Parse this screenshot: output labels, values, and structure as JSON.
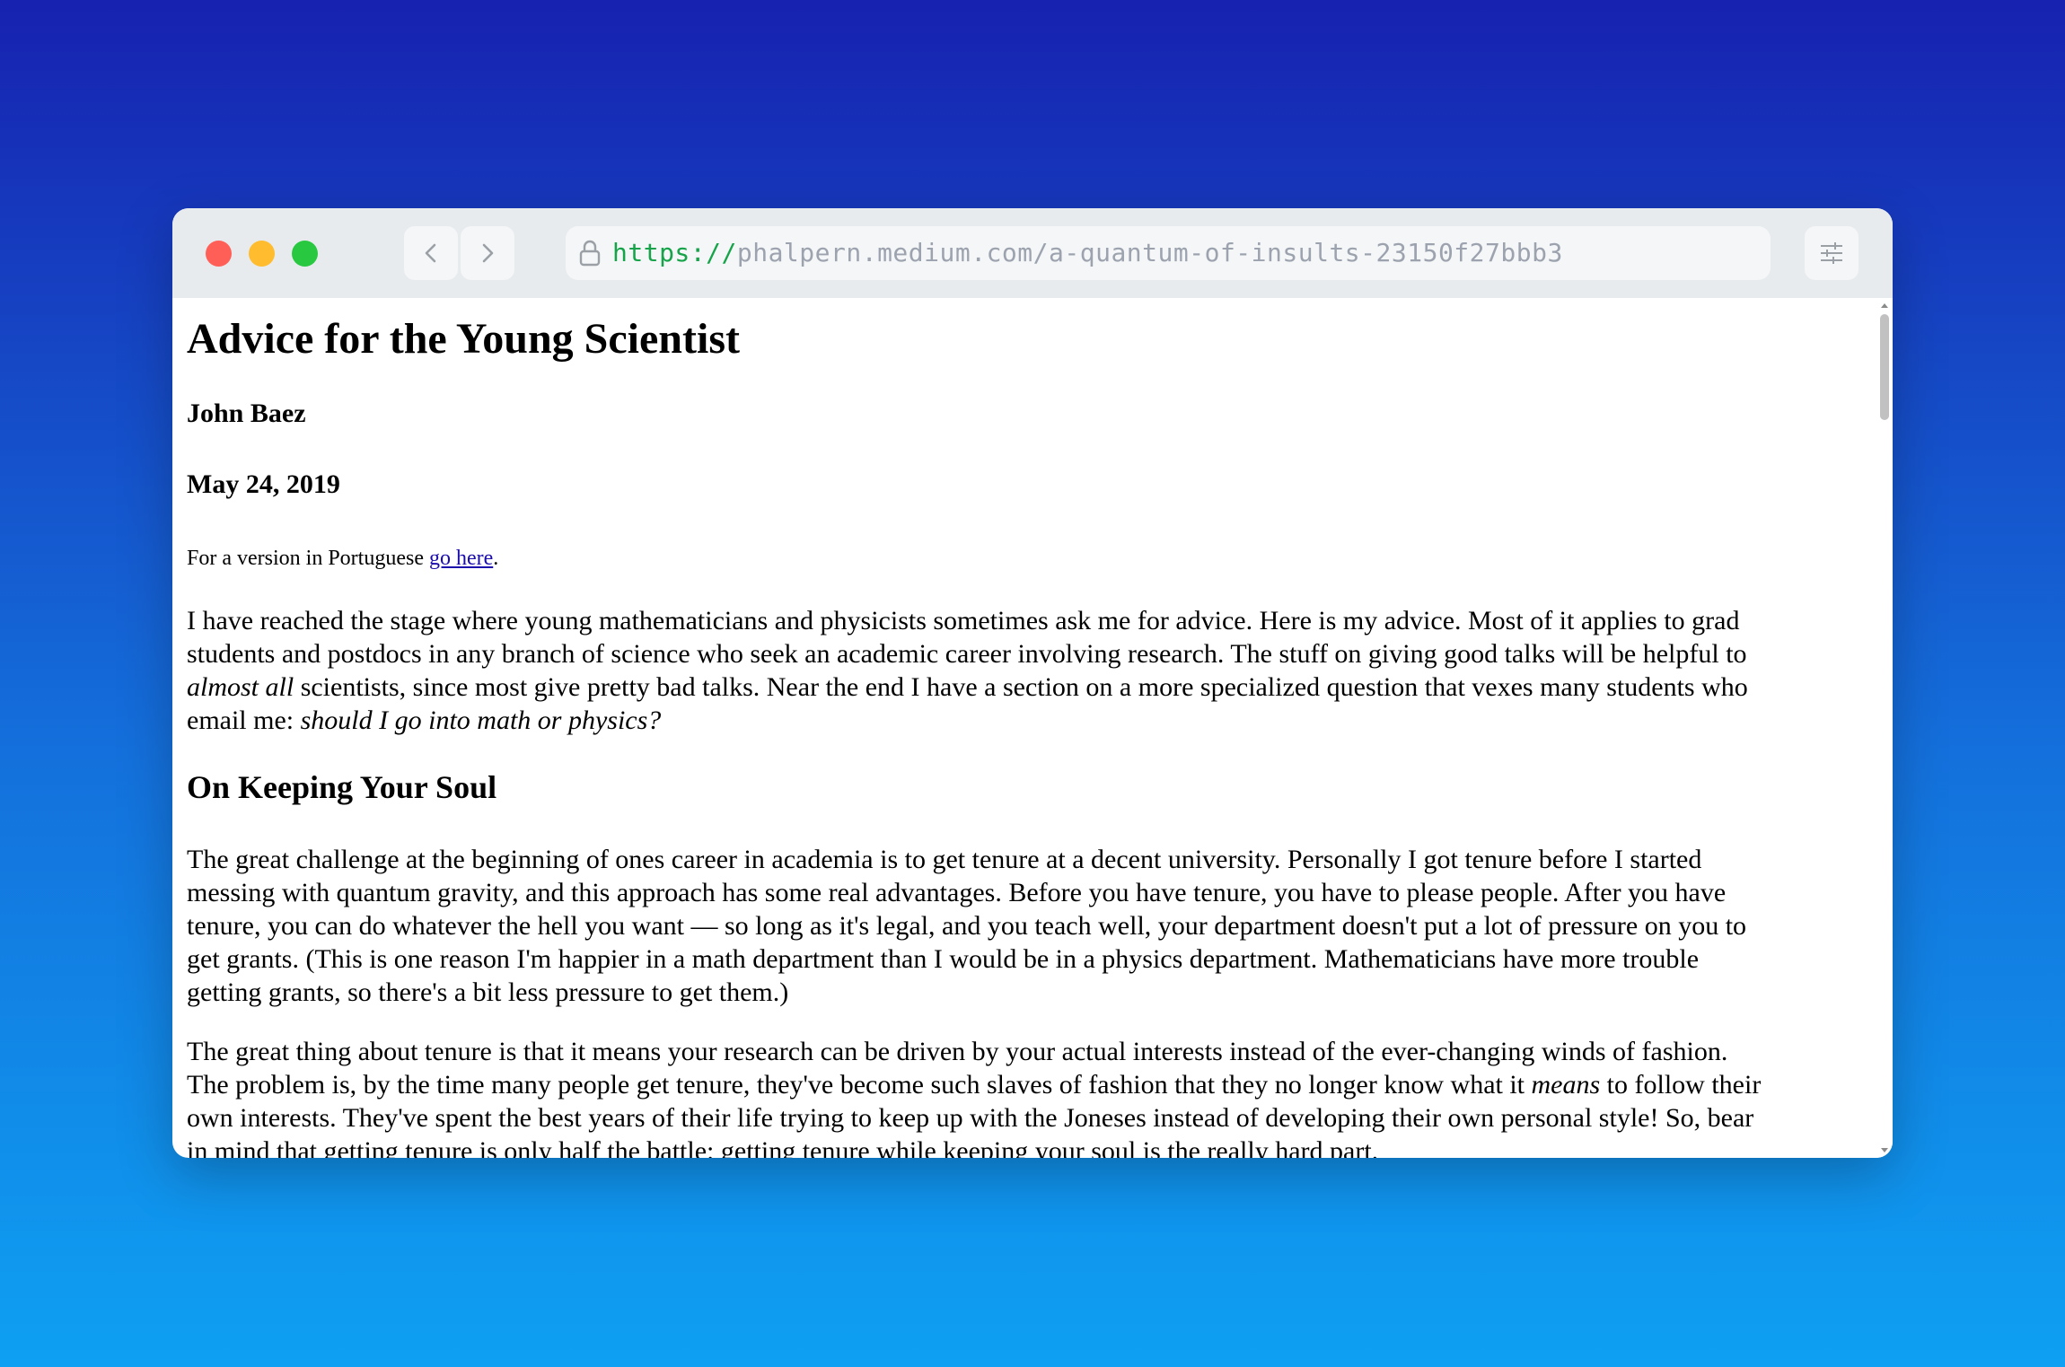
{
  "browser": {
    "url_scheme": "https://",
    "url_rest": "phalpern.medium.com/a-quantum-of-insults-23150f27bbb3",
    "traffic_colors": {
      "close": "#ff5f57",
      "minimize": "#febc2e",
      "maximize": "#28c840"
    }
  },
  "article": {
    "title": "Advice for the Young Scientist",
    "author": "John Baez",
    "date": "May 24, 2019",
    "portuguese_prefix": "For a version in Portuguese ",
    "portuguese_link": "go here",
    "portuguese_suffix": ".",
    "intro": {
      "l1": "I have reached the stage where young mathematicians and physicists sometimes ask me for advice. Here is my advice. Most of it applies to grad",
      "l2": "students and postdocs in any branch of science who seek an academic career involving research. The stuff on giving good talks will be helpful to",
      "l3_em": "almost all",
      "l3_rest": " scientists, since most give pretty bad talks. Near the end I have a section on a more specialized question that vexes many students who",
      "l4_pre": "email me: ",
      "l4_em": "should I go into math or physics?"
    },
    "section_heading": "On Keeping Your Soul",
    "p1": {
      "l1": "The great challenge at the beginning of ones career in academia is to get tenure at a decent university. Personally I got tenure before I started",
      "l2": "messing with quantum gravity, and this approach has some real advantages. Before you have tenure, you have to please people. After you have",
      "l3": "tenure, you can do whatever the hell you want — so long as it's legal, and you teach well, your department doesn't put a lot of pressure on you to",
      "l4": "get grants. (This is one reason I'm happier in a math department than I would be in a physics department. Mathematicians have more trouble",
      "l5": "getting grants, so there's a bit less pressure to get them.)"
    },
    "p2": {
      "l1": "The great thing about tenure is that it means your research can be driven by your actual interests instead of the ever-changing winds of fashion.",
      "l2_pre": "The problem is, by the time many people get tenure, they've become such slaves of fashion that they no longer know what it ",
      "l2_em": "means",
      "l2_post": " to follow their",
      "l3": "own interests. They've spent the best years of their life trying to keep up with the Joneses instead of developing their own personal style! So, bear",
      "l4": "in mind that getting tenure is only half the battle: getting tenure while keeping your soul is the really hard part."
    }
  }
}
